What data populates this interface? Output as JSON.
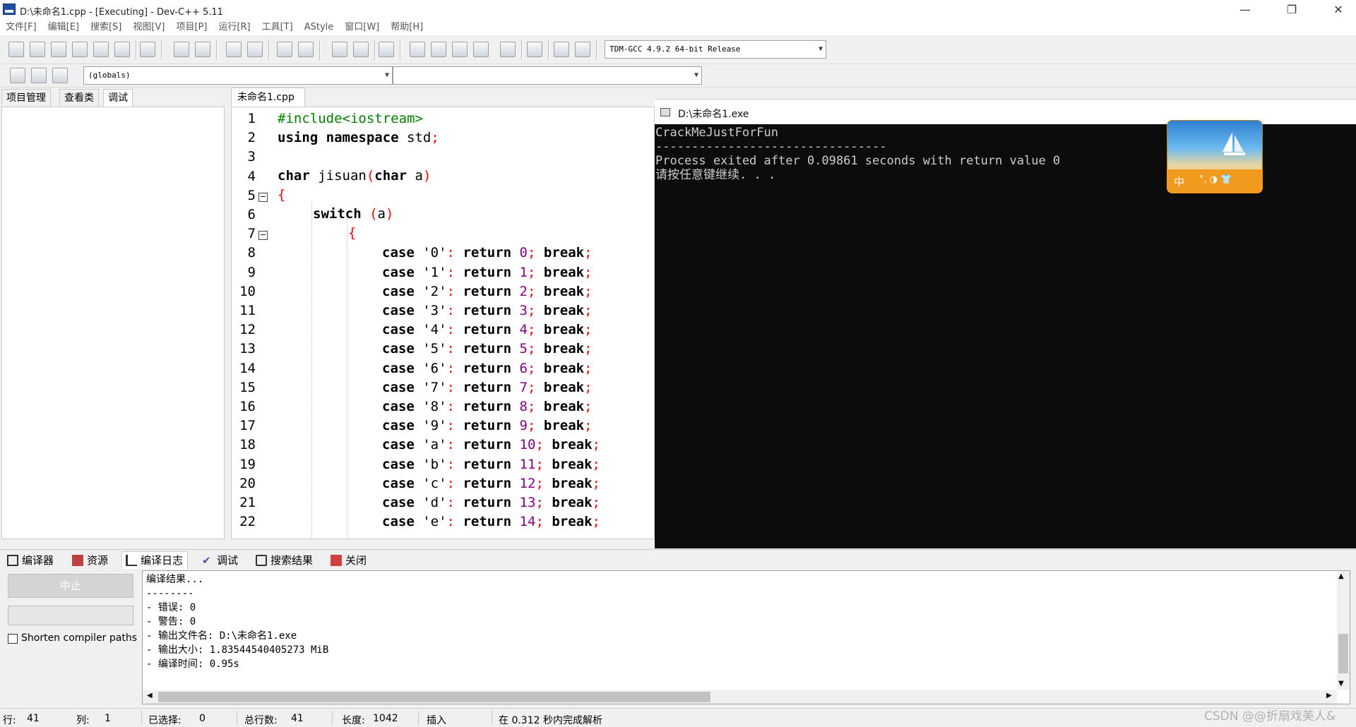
{
  "window": {
    "title": "D:\\未命名1.cpp - [Executing] - Dev-C++ 5.11",
    "minimize": "—",
    "maximize": "❐",
    "close": "✕"
  },
  "menu": [
    "文件[F]",
    "编辑[E]",
    "搜索[S]",
    "视图[V]",
    "项目[P]",
    "运行[R]",
    "工具[T]",
    "AStyle",
    "窗口[W]",
    "帮助[H]"
  ],
  "toolbar": {
    "compiler_select": "TDM-GCC 4.9.2 64-bit Release",
    "scope_select": "(globals)",
    "member_select": ""
  },
  "left_tabs": [
    "项目管理",
    "查看类",
    "调试"
  ],
  "editor": {
    "tab": "未命名1.cpp",
    "line_numbers": [
      "1",
      "2",
      "3",
      "4",
      "5",
      "6",
      "7",
      "8",
      "9",
      "10",
      "11",
      "12",
      "13",
      "14",
      "15",
      "16",
      "17",
      "18",
      "19",
      "20",
      "21",
      "22"
    ]
  },
  "code": {
    "l1_pp": "#include<iostream>",
    "l2_kw": "using namespace",
    "l2_id": " std",
    "l2_semi": ";",
    "l4_kw1": "char",
    "l4_id": " jisuan",
    "l4_p1": "(",
    "l4_kw2": "char",
    "l4_arg": " a",
    "l4_p2": ")",
    "l5": "{",
    "l6_kw": "switch",
    "l6_p1": " (",
    "l6_arg": "a",
    "l6_p2": ")",
    "l7": "{",
    "case_kw": "case",
    "return_kw": "return",
    "break_kw": "break",
    "cases": [
      {
        "ch": "'0'",
        "val": "0"
      },
      {
        "ch": "'1'",
        "val": "1"
      },
      {
        "ch": "'2'",
        "val": "2"
      },
      {
        "ch": "'3'",
        "val": "3"
      },
      {
        "ch": "'4'",
        "val": "4"
      },
      {
        "ch": "'5'",
        "val": "5"
      },
      {
        "ch": "'6'",
        "val": "6"
      },
      {
        "ch": "'7'",
        "val": "7"
      },
      {
        "ch": "'8'",
        "val": "8"
      },
      {
        "ch": "'9'",
        "val": "9"
      },
      {
        "ch": "'a'",
        "val": "10"
      },
      {
        "ch": "'b'",
        "val": "11"
      },
      {
        "ch": "'c'",
        "val": "12"
      },
      {
        "ch": "'d'",
        "val": "13"
      },
      {
        "ch": "'e'",
        "val": "14"
      }
    ]
  },
  "console": {
    "title": "D:\\未命名1.exe",
    "lines": [
      "CrackMeJustForFun",
      "--------------------------------",
      "Process exited after 0.09861 seconds with return value 0",
      "请按任意键继续. . ."
    ]
  },
  "ime": {
    "label": "中",
    "extra": "°, ◑ 👕"
  },
  "bottom_tabs": [
    "编译器",
    "资源",
    "编译日志",
    "调试",
    "搜索结果",
    "关闭"
  ],
  "bottom_panel": {
    "abort_button": "中止",
    "shorten_label": "Shorten compiler paths",
    "log": "编译结果...\n--------\n- 错误: 0\n- 警告: 0\n- 输出文件名: D:\\未命名1.exe\n- 输出大小: 1.83544540405273 MiB\n- 编译时间: 0.95s"
  },
  "status": {
    "row_label": "行:",
    "row": "41",
    "col_label": "列:",
    "col": "1",
    "sel_label": "已选择:",
    "sel": "0",
    "lines_label": "总行数:",
    "lines": "41",
    "len_label": "长度:",
    "len": "1042",
    "mode": "插入",
    "parse": "在 0.312 秒内完成解析"
  },
  "watermark": "CSDN @@折扇戏美人&",
  "colors": {
    "keyword": "#000000",
    "preprocessor": "#008000",
    "number": "#800080",
    "punct": "#ff0000",
    "console_bg": "#0c0c0c"
  }
}
